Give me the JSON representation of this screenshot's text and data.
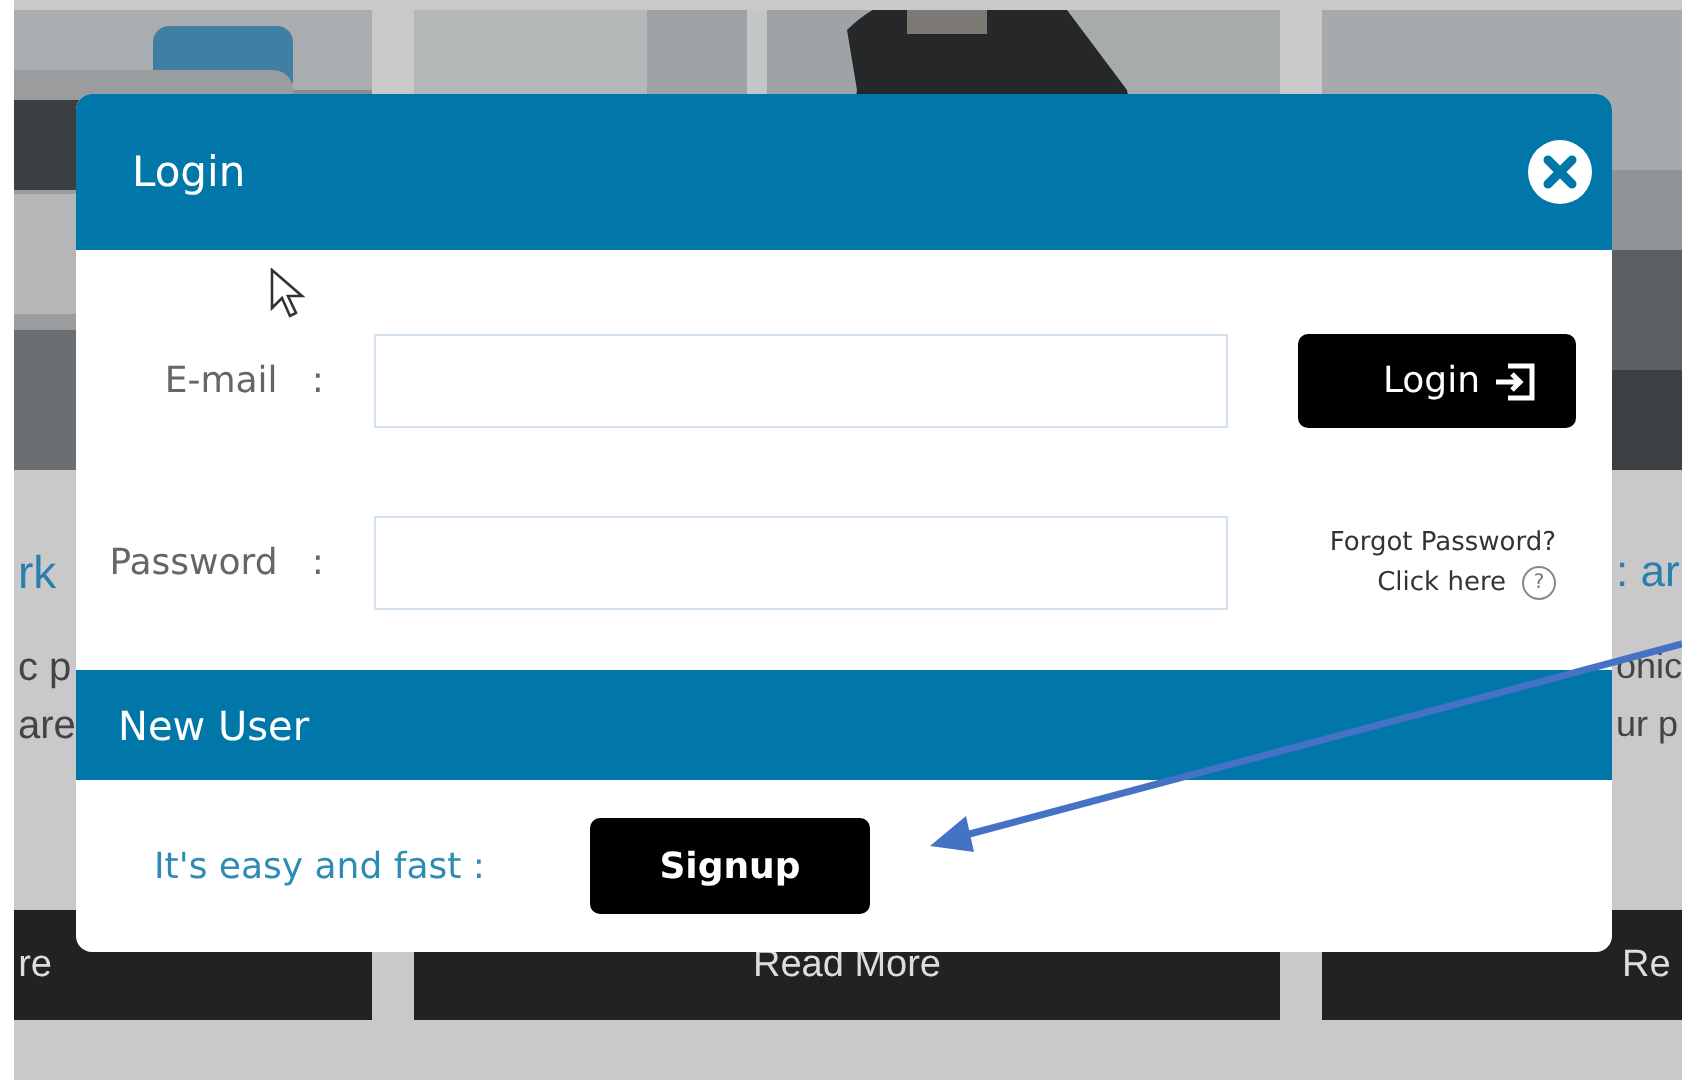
{
  "background_cards": [
    {
      "picture": {
        "kind": "picture"
      },
      "title": "rk",
      "lines": [
        "c p",
        "are"
      ],
      "button": "re"
    },
    {
      "picture": {
        "kind": "picture"
      },
      "button": "Read More"
    },
    {
      "picture": {
        "kind": "picture"
      },
      "title": ": ar",
      "lines": [
        "onic",
        "ur p"
      ],
      "button": "Re"
    }
  ],
  "modal": {
    "title": "Login",
    "fields": [
      {
        "label": "E-mail",
        "separator": ":"
      },
      {
        "label": "Password",
        "separator": ":"
      }
    ],
    "login_button": "Login",
    "forgot": {
      "text": "Forgot Password?",
      "link": "Click here",
      "help_mark": "?"
    },
    "new_user": {
      "title": "New User",
      "prompt": "It's easy and fast :",
      "signup_button": "Signup"
    }
  }
}
